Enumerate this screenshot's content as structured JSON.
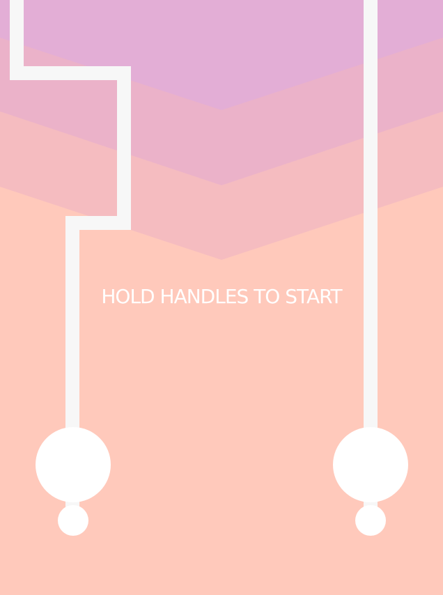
{
  "game": {
    "prompt": "HOLD HANDLES TO START"
  },
  "colors": {
    "background": "#ffc9bb",
    "band_top": "#e3aed6",
    "band_mid": "#ebb2c9",
    "band_low": "#f5bcc0",
    "track": "#f7f7f7",
    "handle": "#ffffff"
  }
}
